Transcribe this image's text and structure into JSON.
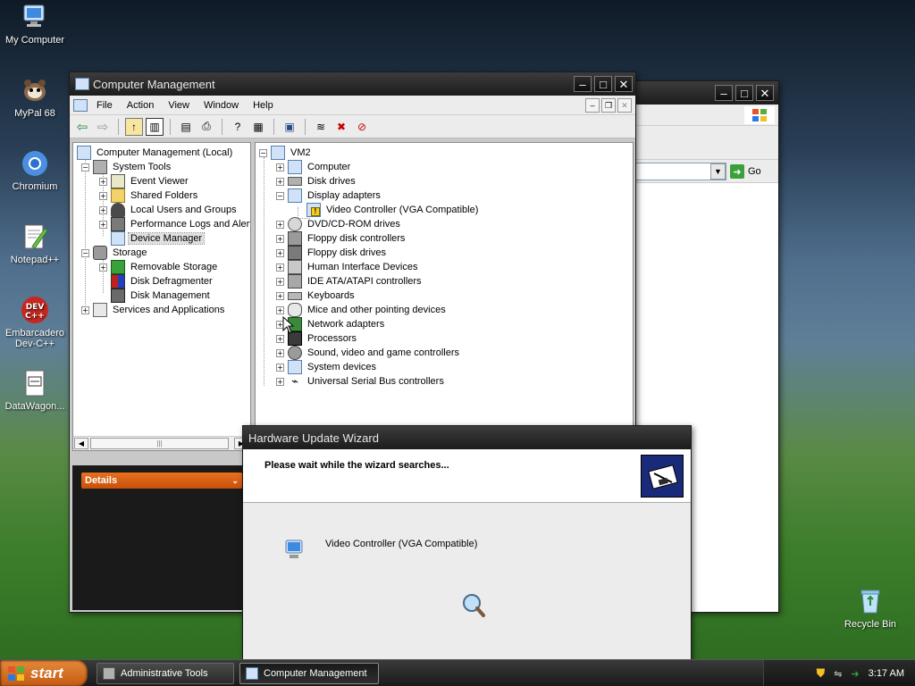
{
  "desktop": {
    "icons": [
      {
        "label": "My Computer"
      },
      {
        "label": "MyPal 68"
      },
      {
        "label": "Chromium"
      },
      {
        "label": "Notepad++"
      },
      {
        "label": "Embarcadero Dev-C++"
      },
      {
        "label": "DataWagon..."
      },
      {
        "label": "Recycle Bin"
      }
    ]
  },
  "back_window": {
    "go_label": "Go"
  },
  "cm_window": {
    "title": "Computer Management",
    "menu": [
      "File",
      "Action",
      "View",
      "Window",
      "Help"
    ],
    "left_tree": [
      {
        "label": "Computer Management (Local)",
        "icon": "computer-management-icon"
      },
      {
        "label": "System Tools",
        "icon": "tools-icon"
      },
      {
        "label": "Event Viewer",
        "icon": "event-viewer-icon"
      },
      {
        "label": "Shared Folders",
        "icon": "shared-folders-icon"
      },
      {
        "label": "Local Users and Groups",
        "icon": "users-icon"
      },
      {
        "label": "Performance Logs and Alerts",
        "icon": "performance-icon"
      },
      {
        "label": "Device Manager",
        "icon": "device-manager-icon"
      },
      {
        "label": "Storage",
        "icon": "storage-icon"
      },
      {
        "label": "Removable Storage",
        "icon": "removable-storage-icon"
      },
      {
        "label": "Disk Defragmenter",
        "icon": "defrag-icon"
      },
      {
        "label": "Disk Management",
        "icon": "disk-management-icon"
      },
      {
        "label": "Services and Applications",
        "icon": "services-icon"
      }
    ],
    "details_label": "Details",
    "device_tree": [
      {
        "label": "VM2"
      },
      {
        "label": "Computer"
      },
      {
        "label": "Disk drives"
      },
      {
        "label": "Display adapters"
      },
      {
        "label": "Video Controller (VGA Compatible)"
      },
      {
        "label": "DVD/CD-ROM drives"
      },
      {
        "label": "Floppy disk controllers"
      },
      {
        "label": "Floppy disk drives"
      },
      {
        "label": "Human Interface Devices"
      },
      {
        "label": "IDE ATA/ATAPI controllers"
      },
      {
        "label": "Keyboards"
      },
      {
        "label": "Mice and other pointing devices"
      },
      {
        "label": "Network adapters"
      },
      {
        "label": "Processors"
      },
      {
        "label": "Sound, video and game controllers"
      },
      {
        "label": "System devices"
      },
      {
        "label": "Universal Serial Bus controllers"
      }
    ]
  },
  "wizard": {
    "title": "Hardware Update Wizard",
    "heading": "Please wait while the wizard searches...",
    "device": "Video Controller (VGA Compatible)"
  },
  "taskbar": {
    "start_label": "start",
    "buttons": [
      "Administrative Tools",
      "Computer Management"
    ],
    "clock": "3:17 AM"
  },
  "colors": {
    "start_orange": "#c25a12",
    "title_bar": "#1c1c1c",
    "details_orange": "#e0601a"
  }
}
